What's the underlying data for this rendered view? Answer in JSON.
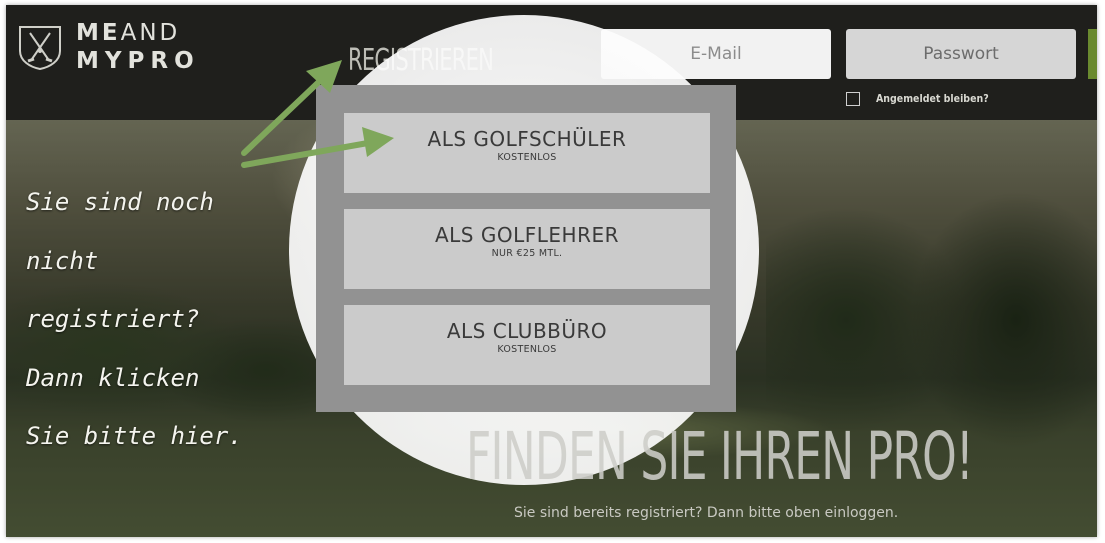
{
  "header": {
    "logo_line1_bold": "ME",
    "logo_line1_rest": "AND",
    "logo_line2": "MYPRO",
    "register_label": "REGISTRIEREN",
    "email_placeholder": "E-Mail",
    "password_placeholder": "Passwort",
    "remember_label": "Angemeldet bleiben?"
  },
  "dropdown": {
    "items": [
      {
        "title": "ALS GOLFSCHÜLER",
        "subtitle": "KOSTENLOS"
      },
      {
        "title": "ALS GOLFLEHRER",
        "subtitle": "NUR €25 MTL."
      },
      {
        "title": "ALS CLUBBÜRO",
        "subtitle": "KOSTENLOS"
      }
    ]
  },
  "annotation": {
    "lines": [
      "Sie sind noch",
      "nicht",
      "registriert?",
      "Dann klicken",
      "Sie bitte hier."
    ]
  },
  "hero": {
    "title": "FINDEN SIE IHREN PRO!",
    "subtitle": "Sie sind bereits registriert? Dann bitte oben einloggen."
  },
  "colors": {
    "header_bg": "#1f1f1c",
    "arrow_green": "#7fa75b",
    "login_green": "#6a8a2f"
  },
  "icons": {
    "logo": "crossed-golf-clubs-icon",
    "arrow": "green-arrow-icon"
  }
}
